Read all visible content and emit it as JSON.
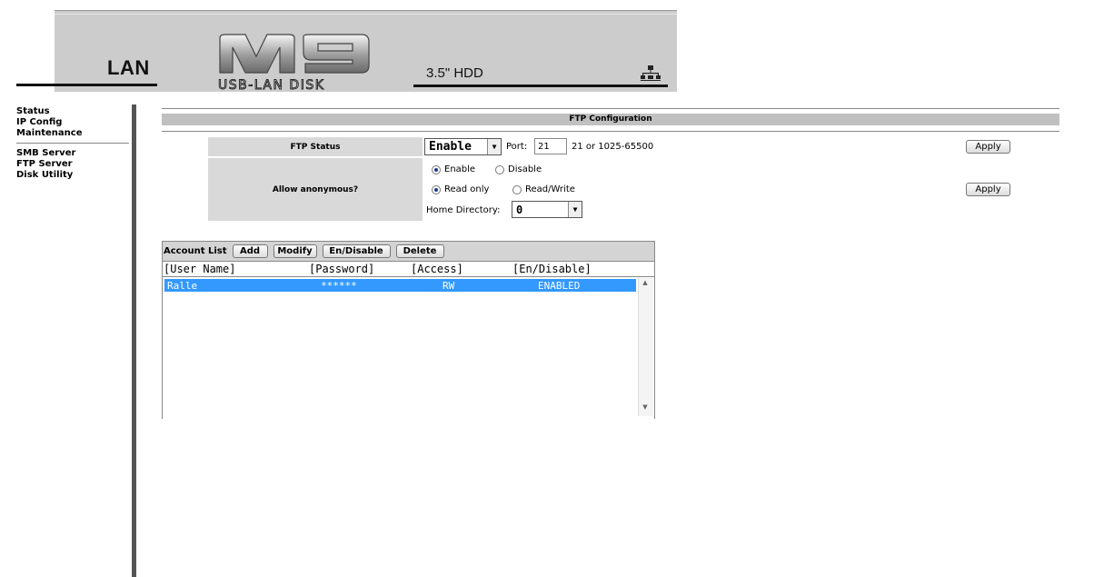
{
  "header": {
    "section_title": "LAN",
    "logo_text": "USB-LAN DISK",
    "device_label": "3.5\" HDD",
    "network_icon": "network-icon"
  },
  "sidebar": {
    "items_top": [
      "Status",
      "IP Config",
      "Maintenance"
    ],
    "items_bottom": [
      "SMB Server",
      "FTP Server",
      "Disk Utility"
    ]
  },
  "ftp_config": {
    "title": "FTP Configuration",
    "status_label": "FTP Status",
    "status_value": "Enable",
    "port_label": "Port:",
    "port_value": "21",
    "port_range": "21 or 1025-65500",
    "apply_label": "Apply",
    "anonymous_label": "Allow anonymous?",
    "anon_enable": "Enable",
    "anon_disable": "Disable",
    "read_only": "Read only",
    "read_write": "Read/Write",
    "home_dir_label": "Home Directory:",
    "home_dir_value": "0"
  },
  "account_list": {
    "title": "Account List",
    "buttons": {
      "add": "Add",
      "modify": "Modify",
      "endis": "En/Disable",
      "delete": "Delete"
    },
    "columns": [
      "[User Name]",
      "[Password]",
      "[Access]",
      "[En/Disable]"
    ],
    "rows": [
      {
        "user": "Ralle",
        "password": "******",
        "access": "RW",
        "status": "ENABLED"
      }
    ]
  },
  "colors": {
    "selected_row": "#3399ff",
    "banner": "#cccccc",
    "config_bar": "#c0c0c0"
  }
}
